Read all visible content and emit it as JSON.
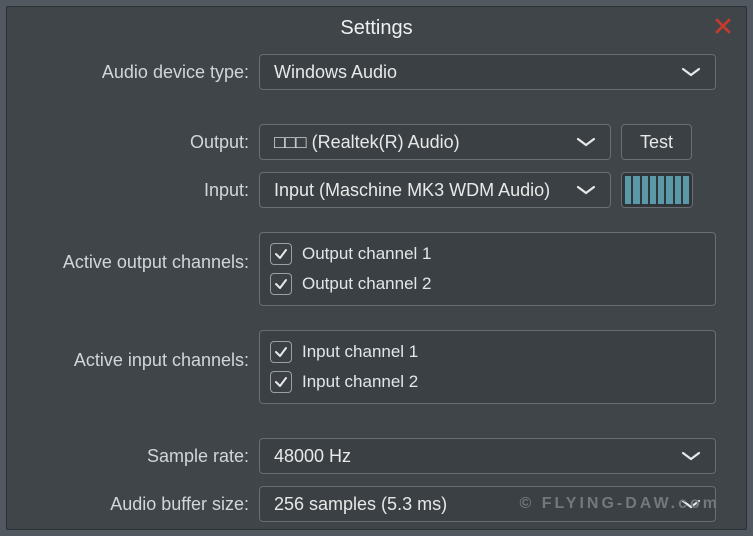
{
  "title": "Settings",
  "labels": {
    "device_type": "Audio device type:",
    "output": "Output:",
    "input": "Input:",
    "active_out": "Active output channels:",
    "active_in": "Active input channels:",
    "sample_rate": "Sample rate:",
    "buffer_size": "Audio buffer size:"
  },
  "values": {
    "device_type": "Windows Audio",
    "output": "□□□ (Realtek(R) Audio)",
    "input": "Input (Maschine MK3 WDM Audio)",
    "sample_rate": "48000 Hz",
    "buffer_size": "256 samples (5.3 ms)",
    "test_btn": "Test"
  },
  "active_output_channels": [
    {
      "label": "Output channel 1",
      "checked": true
    },
    {
      "label": "Output channel 2",
      "checked": true
    }
  ],
  "active_input_channels": [
    {
      "label": "Input channel 1",
      "checked": true
    },
    {
      "label": "Input channel 2",
      "checked": true
    }
  ],
  "watermark": "© FLYING-DAW.com"
}
